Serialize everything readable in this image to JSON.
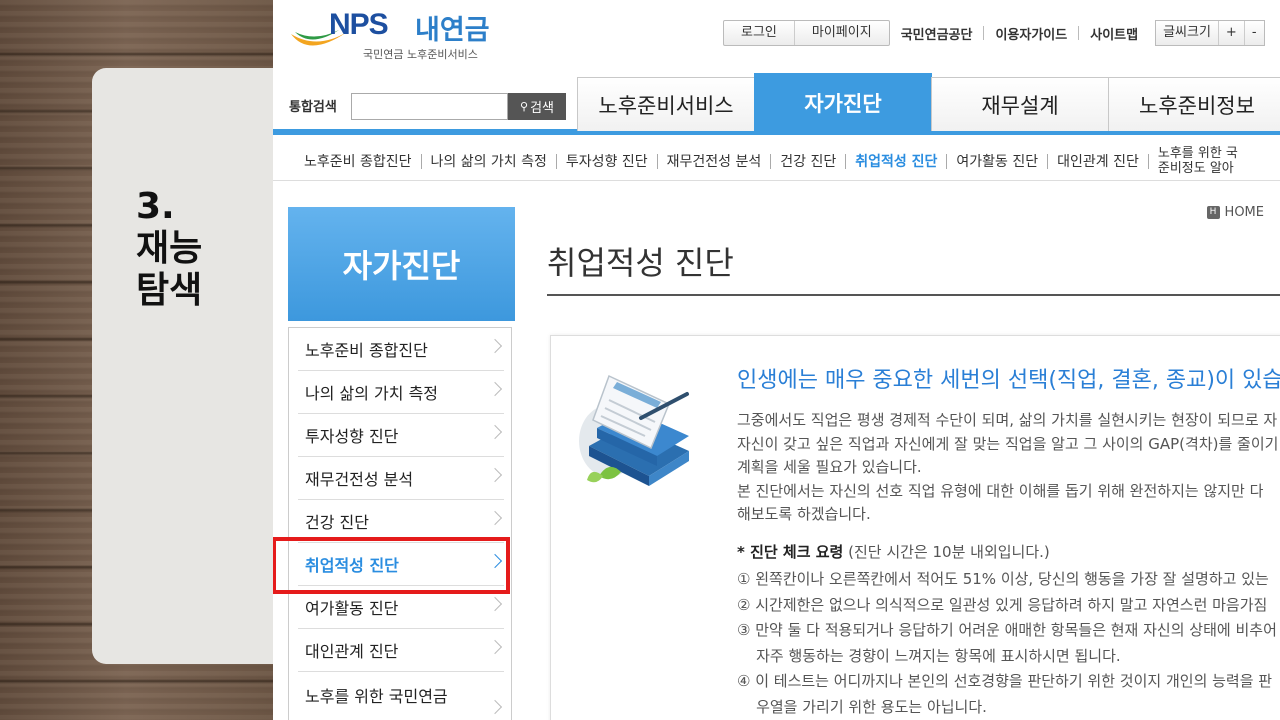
{
  "slide": {
    "title": "3.\n재능\n탐색"
  },
  "logo": {
    "brand": "NPS",
    "brand_kr": "내연금",
    "subtitle": "국민연금 노후준비서비스"
  },
  "util": {
    "login": "로그인",
    "mypage": "마이페이지",
    "nps": "국민연금공단",
    "guide": "이용자가이드",
    "sitemap": "사이트맵",
    "font_size": "글씨크기",
    "plus": "+",
    "minus": "-"
  },
  "search": {
    "label": "통합검색",
    "button": "검색",
    "value": ""
  },
  "tabs": [
    {
      "label": "노후준비서비스"
    },
    {
      "label": "자가진단"
    },
    {
      "label": "재무설계"
    },
    {
      "label": "노후준비정보"
    }
  ],
  "subnav": {
    "items": [
      "노후준비 종합진단",
      "나의 삶의 가치 측정",
      "투자성향 진단",
      "재무건전성 분석",
      "건강 진단",
      "취업적성 진단",
      "여가활동 진단",
      "대인관계 진단"
    ],
    "last_line1": "노후를 위한 국",
    "last_line2": "준비정도 알아"
  },
  "lnb": {
    "title": "자가진단",
    "items": [
      "노후준비 종합진단",
      "나의 삶의 가치 측정",
      "투자성향 진단",
      "재무건전성 분석",
      "건강 진단",
      "취업적성 진단",
      "여가활동 진단",
      "대인관계 진단",
      "노후를 위한 국민연금"
    ]
  },
  "breadcrumb": {
    "home": "HOME"
  },
  "page": {
    "title": "취업적성 진단",
    "headline": "인생에는 매우 중요한 세번의 선택(직업, 결혼, 종교)이 있습니다",
    "para": [
      "그중에서도 직업은 평생 경제적 수단이 되며, 삶의 가치를 실현시키는 현장이 되므로 자",
      "자신이 갖고 싶은 직업과 자신에게 잘 맞는 직업을 알고 그 사이의 GAP(격차)를 줄이기",
      "계획을 세울 필요가 있습니다.",
      "본 진단에서는 자신의 선호 직업 유형에 대한 이해를 돕기 위해 완전하지는 않지만 다",
      "해보도록 하겠습니다."
    ],
    "check_title": "* 진단 체크 요령",
    "check_note": "(진단 시간은 10분 내외입니다.)",
    "check_list": [
      "① 왼쪽칸이나 오른쪽칸에서 적어도 51% 이상, 당신의 행동을 가장 잘 설명하고 있는",
      "② 시간제한은 없으나 의식적으로 일관성 있게 응답하려 하지 말고 자연스런 마음가짐",
      "③ 만약 둘 다 적용되거나 응답하기 어려운 애매한 항목들은 현재 자신의 상태에 비추어",
      "    자주 행동하는 경향이 느껴지는 항목에 표시하시면 됩니다.",
      "④ 이 테스트는 어디까지나 본인의 선호경향을 판단하기 위한 것이지 개인의 능력을 판",
      "    우열을 가리기 위한 용도는 아닙니다."
    ]
  },
  "colors": {
    "accent": "#3d9be0",
    "highlight": "#e51b1b",
    "link": "#2a8de0"
  }
}
